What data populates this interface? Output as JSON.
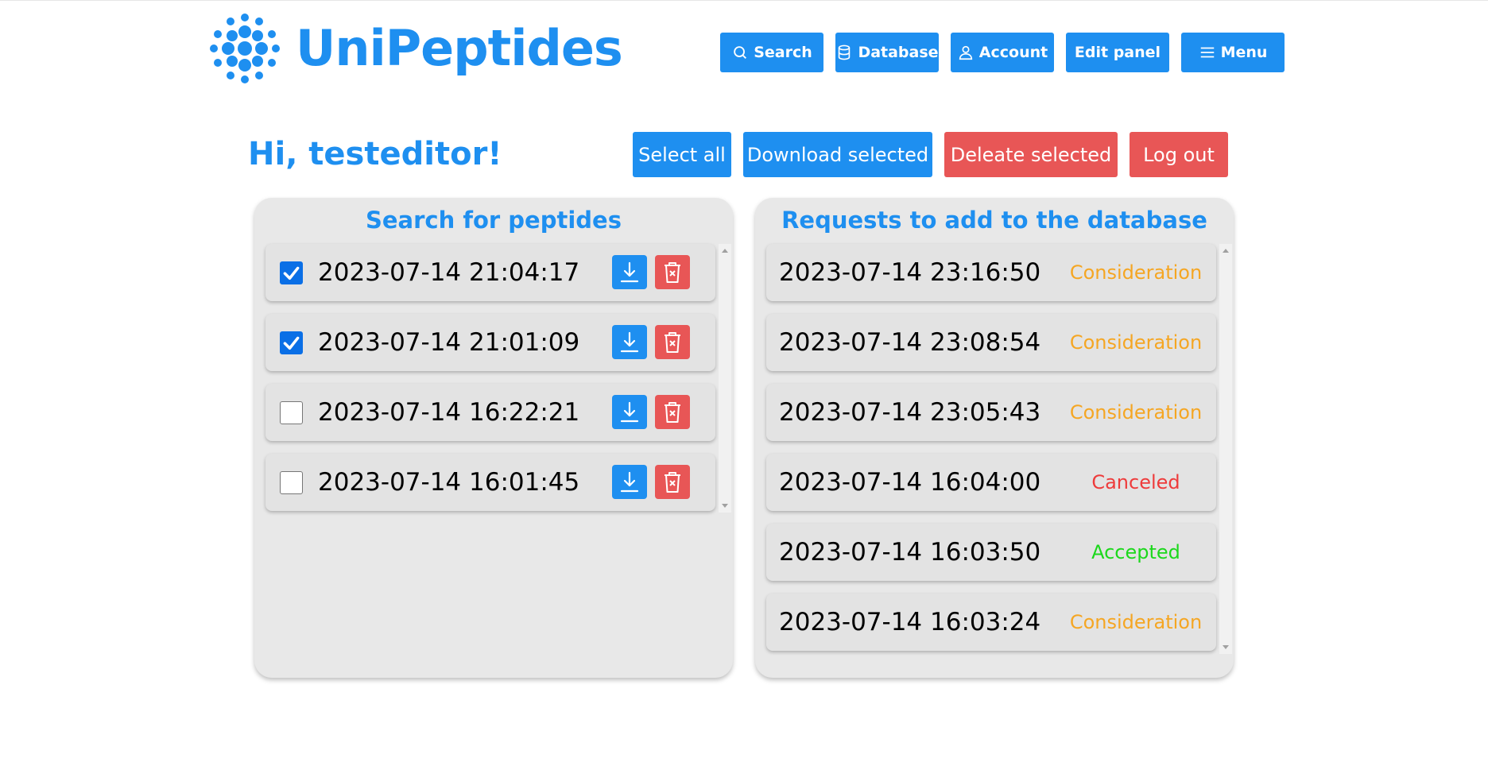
{
  "header": {
    "brand": "UniPeptides",
    "nav": [
      {
        "label": "Search",
        "icon": "search-icon"
      },
      {
        "label": "Database",
        "icon": "database-icon"
      },
      {
        "label": "Account",
        "icon": "user-icon"
      },
      {
        "label": "Edit panel",
        "icon": ""
      },
      {
        "label": "Menu",
        "icon": "hamburger-icon"
      }
    ]
  },
  "greeting": "Hi, testeditor!",
  "actions": {
    "select_all": "Select all",
    "download_selected": "Download selected",
    "delete_selected": "Deleate selected",
    "logout": "Log out"
  },
  "searches_panel": {
    "title": "Search for peptides",
    "items": [
      {
        "date": "2023-07-14 21:04:17",
        "checked": true
      },
      {
        "date": "2023-07-14 21:01:09",
        "checked": true
      },
      {
        "date": "2023-07-14 16:22:21",
        "checked": false
      },
      {
        "date": "2023-07-14 16:01:45",
        "checked": false
      }
    ]
  },
  "requests_panel": {
    "title": "Requests to add to the database",
    "items": [
      {
        "date": "2023-07-14 23:16:50",
        "status": "Consideration"
      },
      {
        "date": "2023-07-14 23:08:54",
        "status": "Consideration"
      },
      {
        "date": "2023-07-14 23:05:43",
        "status": "Consideration"
      },
      {
        "date": "2023-07-14 16:04:00",
        "status": "Canceled"
      },
      {
        "date": "2023-07-14 16:03:50",
        "status": "Accepted"
      },
      {
        "date": "2023-07-14 16:03:24",
        "status": "Consideration"
      }
    ]
  },
  "colors": {
    "primary": "#1e8ff0",
    "danger": "#e85656",
    "consideration": "#f5a623",
    "canceled": "#ee3b3b",
    "accepted": "#1cd81c"
  }
}
